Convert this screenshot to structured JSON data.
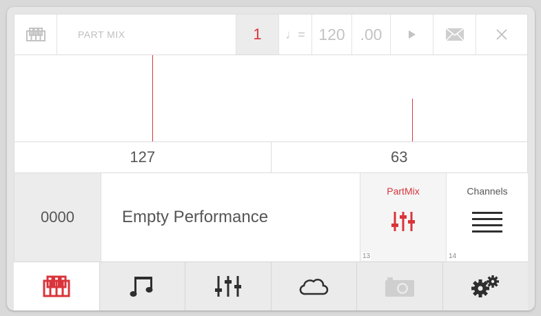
{
  "header": {
    "logo_icon": "piano-keys-icon",
    "title": "PART MIX",
    "part_number": "1",
    "tempo_symbol": "♩=",
    "tempo": "120",
    "tempo_fraction": ".00",
    "play_icon": "play-icon",
    "mail_icon": "envelope-icon",
    "close_icon": "close-icon"
  },
  "meters": {
    "left_value": "127",
    "right_value": "63",
    "left_level": 127,
    "right_level": 63,
    "max_level": 127
  },
  "performance": {
    "number": "0000",
    "name": "Empty Performance"
  },
  "mode_buttons": [
    {
      "label": "PartMix",
      "icon": "mixer-sliders-icon",
      "index": "13",
      "active": true
    },
    {
      "label": "Channels",
      "icon": "list-lines-icon",
      "index": "14",
      "active": false
    }
  ],
  "bottom_nav": [
    {
      "icon": "piano-keys-icon",
      "active": true
    },
    {
      "icon": "music-note-icon",
      "active": false
    },
    {
      "icon": "mixer-sliders-icon",
      "active": false
    },
    {
      "icon": "cloud-icon",
      "active": false
    },
    {
      "icon": "camera-icon",
      "active": false,
      "disabled": true
    },
    {
      "icon": "gears-icon",
      "active": false
    }
  ],
  "colors": {
    "accent": "#d9343b",
    "text": "#555555",
    "muted": "#c3c3c3",
    "panel": "#ececec"
  }
}
